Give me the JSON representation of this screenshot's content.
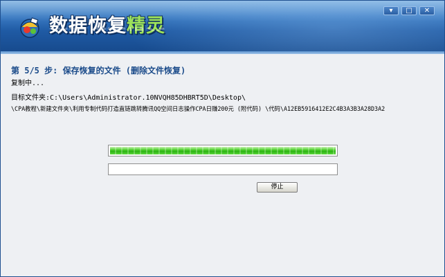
{
  "app": {
    "title_main": "数据恢复",
    "title_accent": "精灵",
    "window_controls": [
      "▾",
      "□",
      "✕"
    ]
  },
  "step": {
    "title": "第 5/5 步: 保存恢复的文件 (删除文件恢复)",
    "status": "复制中...",
    "target_label": "目标文件夹:",
    "target_path": "C:\\Users\\Administrator.10NVQH85DHBRT5D\\Desktop\\",
    "current_file": "\\CPA教程\\新建文件夹\\利用专制代码打造直链跳转腾讯QQ空间日志操作CPA日赚200元 (附代码) \\代码\\A12EB5916412E2C4B3A3B3A28D3A2"
  },
  "progress": {
    "file_progress": 1.0,
    "overall_progress": 0.0
  },
  "buttons": {
    "stop_label": "停止"
  },
  "colors": {
    "header_blue": "#1F5AA4",
    "title_accent_green": "#9EE35A",
    "progress_green": "#2BB312",
    "step_title_blue": "#1B4B8A"
  },
  "icons": {
    "logo": "data-recovery-logo-icon"
  }
}
